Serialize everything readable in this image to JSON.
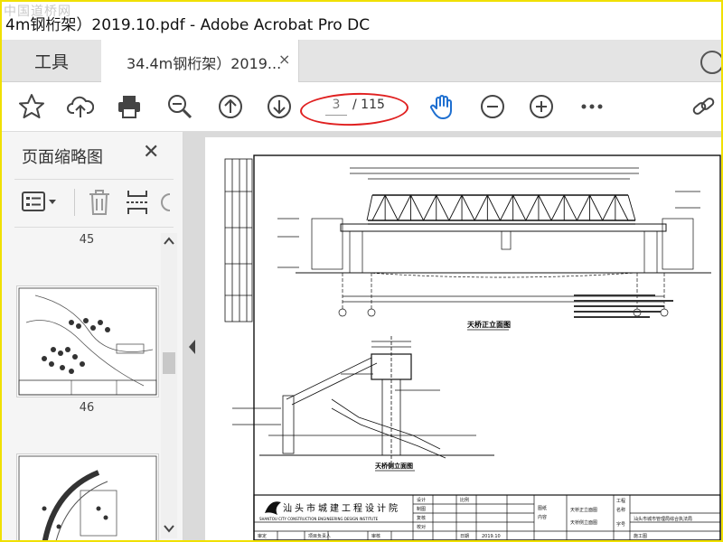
{
  "window": {
    "title": "4m钢桁架）2019.10.pdf - Adobe Acrobat Pro DC",
    "watermark": "中国道桥网"
  },
  "tabs": {
    "tools_label": "工具",
    "document_label": "34.4m钢桁架）2019...",
    "close_glyph": "×"
  },
  "toolbar": {
    "current_page": "3",
    "page_total": "/ 115",
    "icons": [
      "star-icon",
      "cloud-upload-icon",
      "print-icon",
      "zoom-out-search-icon",
      "page-up-icon",
      "page-down-icon",
      "hand-tool-icon",
      "zoom-out-icon",
      "zoom-in-icon",
      "more-icon",
      "share-link-icon"
    ]
  },
  "sidebar": {
    "title": "页面缩略图",
    "close_glyph": "✕",
    "pages": [
      "45",
      "46"
    ]
  },
  "drawing": {
    "company_cn": "汕头市城建工程设计院",
    "company_en": "SHANTOU CITY CONSTRUCTION ENGINEERING DESIGN INSTITUTE",
    "front_view_title": "天桥正立面图",
    "side_view_title": "天桥侧立面图",
    "sheet_titles": [
      "天桥正立面图",
      "天桥侧立面图"
    ],
    "date": "2019.10",
    "labels": {
      "review": "审定",
      "audit": "审核",
      "project_lead": "项目负责人",
      "specialty_lead": "专业负责人",
      "design": "设计",
      "check": "复核",
      "draw": "制图",
      "date_label": "日期",
      "scale": "比例",
      "proofread": "校对",
      "drawing_no": "图纸",
      "content": "内容",
      "project": "工程",
      "name": "名称",
      "word": "字号",
      "engineering": "施工图"
    },
    "project_name": "汕头市城市管理局综合执法局",
    "accent_color": "#e02020",
    "drawing_color": "#111111"
  }
}
